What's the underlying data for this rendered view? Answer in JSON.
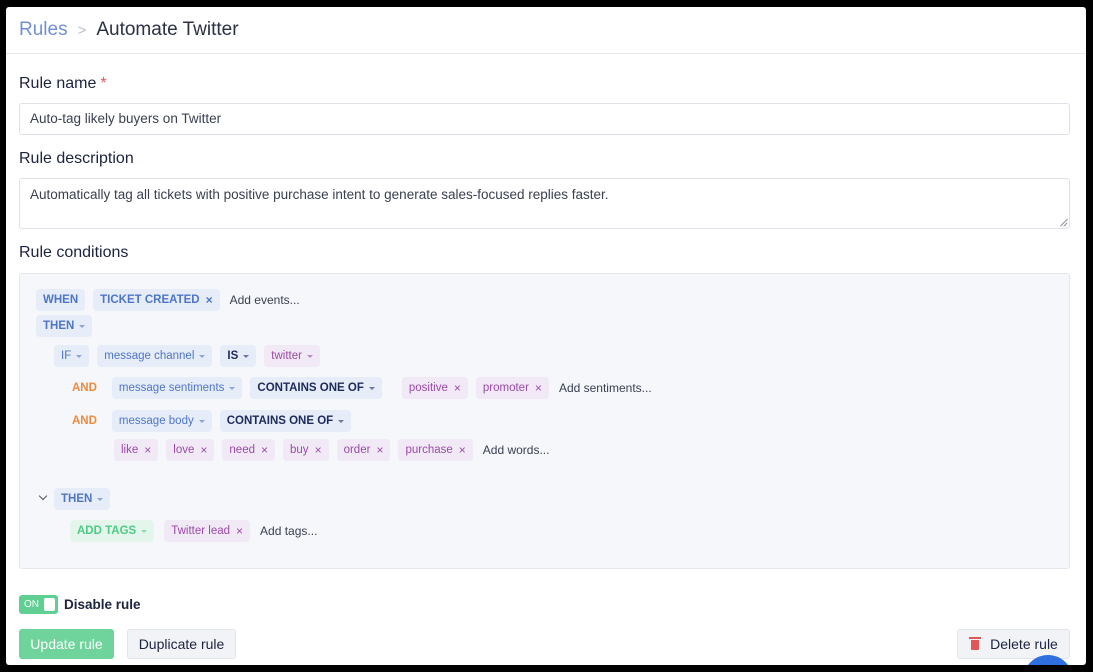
{
  "breadcrumb": {
    "parent": "Rules",
    "separator": ">",
    "current": "Automate Twitter"
  },
  "form": {
    "name_label": "Rule name",
    "required_mark": "*",
    "name_value": "Auto-tag likely buyers on Twitter",
    "description_label": "Rule description",
    "description_value": "Automatically tag all tickets with positive purchase intent to generate sales-focused replies faster.",
    "conditions_label": "Rule conditions"
  },
  "conditions": {
    "when": "WHEN",
    "event_chip": "TICKET CREATED",
    "add_events": "Add events...",
    "then": "THEN",
    "if": "IF",
    "field1": "message channel",
    "op1": "IS",
    "value1": "twitter",
    "and1": "AND",
    "field2": "message sentiments",
    "op2": "CONTAINS ONE OF",
    "sentiments": [
      "positive",
      "promoter"
    ],
    "add_sentiments": "Add sentiments...",
    "and2": "AND",
    "field3": "message body",
    "op3": "CONTAINS ONE OF",
    "words": [
      "like",
      "love",
      "need",
      "buy",
      "order",
      "purchase"
    ],
    "add_words": "Add words...",
    "then2": "THEN",
    "action": "ADD TAGS",
    "tag": "Twitter lead",
    "add_tags": "Add tags..."
  },
  "toggle": {
    "state": "ON",
    "label": "Disable rule"
  },
  "buttons": {
    "update": "Update rule",
    "duplicate": "Duplicate rule",
    "delete": "Delete rule"
  },
  "icons": {
    "remove": "×"
  },
  "colors": {
    "accent_blue": "#4e75c8",
    "tag_purple": "#9a4aa8",
    "and_orange": "#f08a3c",
    "action_green": "#4fca86",
    "danger": "#e15757"
  }
}
